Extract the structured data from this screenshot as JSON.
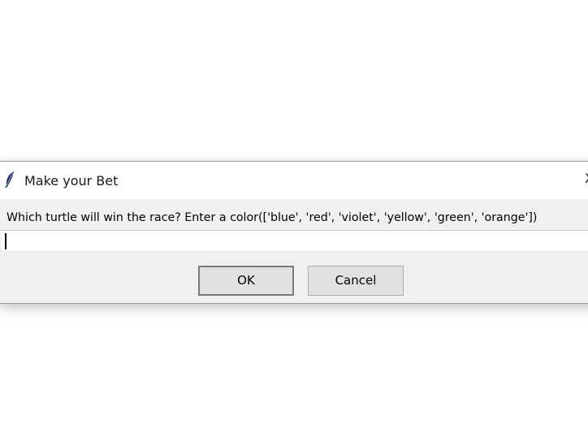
{
  "dialog": {
    "title": "Make your Bet",
    "close_symbol": "X",
    "icon": "feather-icon",
    "prompt": "Which turtle will win the race? Enter a color(['blue', 'red', 'violet', 'yellow', 'green', 'orange'])",
    "input_value": "",
    "buttons": {
      "ok_label": "OK",
      "cancel_label": "Cancel"
    }
  }
}
